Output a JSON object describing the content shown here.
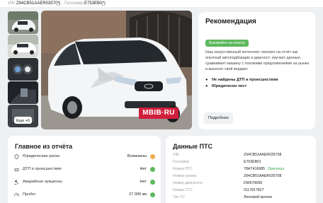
{
  "topbar": {
    "vin_label": "VIN",
    "vin_value": "Z94CB51AAER035708",
    "gosnomer_label": "Госномер",
    "gosnomer_value": "Е753ЕВ01"
  },
  "gallery": {
    "more_label": "Еще +6",
    "watermark": "MBIB·RU",
    "car_color": "#f4f5f6"
  },
  "recommendation": {
    "title": "Рекомендация",
    "badge": "Выезжайте на осмотр",
    "text": "Наш искусственный интеллект смотрит на отчёт как опытный автоподборщик и диагност: изучает данные, сравнивает машину с похожими предложениями на рынке и выносит свой вердикт.",
    "checks": [
      "Не найдены ДТП и происшествия",
      "Юридически чист"
    ],
    "more_button": "Подробнее",
    "accent": "#5cb85c"
  },
  "highlights": {
    "title": "Главное из отчёта",
    "rows": [
      {
        "label": "Юридические риски",
        "value": "Возможны",
        "status": "warning"
      },
      {
        "label": "ДТП и происшествия",
        "value": "Нет",
        "status": "ok"
      },
      {
        "label": "Аварийные аукционы",
        "value": "Нет",
        "status": "ok"
      },
      {
        "label": "Пробег",
        "value": "27 000 км",
        "status": "ok"
      }
    ]
  },
  "pts": {
    "title": "Данные ПТС",
    "rows": [
      {
        "label": "VIN",
        "value": "Z94CB51AAER035708",
        "tag": ""
      },
      {
        "label": "Госномер",
        "value": "Е753ЕВ01",
        "tag": ""
      },
      {
        "label": "Номер ПТС",
        "value": "78НТ416685",
        "tag": "Оригинал"
      },
      {
        "label": "Номер кузова",
        "value": "Z94CB51AAER035708",
        "tag": ""
      },
      {
        "label": "Номер двигателя",
        "value": "DW670698",
        "tag": ""
      },
      {
        "label": "Номер СТС",
        "value": "0117817827",
        "tag": ""
      },
      {
        "label": "Тип ТС",
        "value": "Легковой прочее",
        "tag": ""
      }
    ]
  }
}
